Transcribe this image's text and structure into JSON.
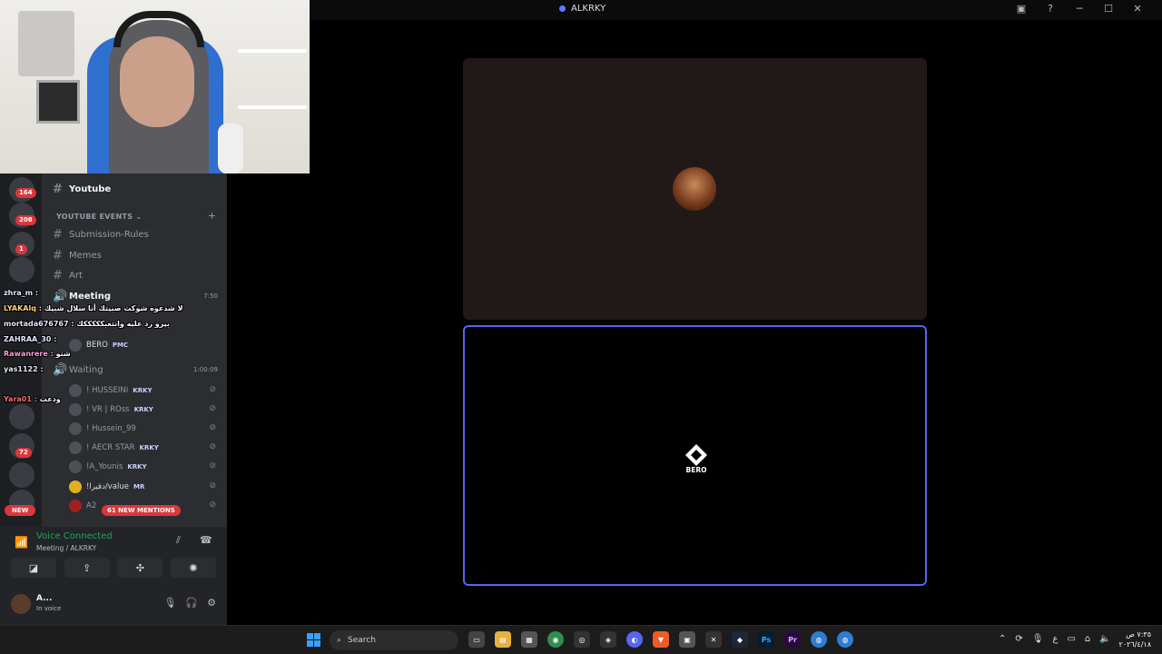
{
  "window": {
    "title": "ALKRKY"
  },
  "servers": {
    "badges": [
      "164",
      "208",
      "1",
      "72"
    ],
    "new_label": "NEW"
  },
  "channels": {
    "top_channel": "Youtube",
    "category": "YOUTUBE EVENTS",
    "items": [
      {
        "name": "Submission-Rules"
      },
      {
        "name": "Memes"
      },
      {
        "name": "Art"
      }
    ],
    "voice_meeting": {
      "name": "Meeting",
      "time": "7:50"
    },
    "meeting_members": [
      {
        "name": "BERO",
        "tag": "PMC"
      }
    ],
    "voice_waiting": {
      "name": "Waiting",
      "time": "1:00:09"
    },
    "waiting_members": [
      {
        "name": "! HUSSEINI",
        "tag": "KRKY"
      },
      {
        "name": "! VR | ROss",
        "tag": "KRKY"
      },
      {
        "name": "! Hussein_99",
        "tag": ""
      },
      {
        "name": "! AECR STAR",
        "tag": "KRKY"
      },
      {
        "name": "!A_Younis",
        "tag": "KRKY"
      },
      {
        "name": "!دقيرا/value",
        "tag": "MR"
      },
      {
        "name": "A2",
        "tag": ""
      }
    ],
    "mentions": "61 NEW MENTIONS"
  },
  "chat": [
    {
      "user": "zhra_m :",
      "msg": ""
    },
    {
      "user": "LYAKAlq :",
      "msg": "لا شدعوه شوكت صبيتك أنا سلال شبيك"
    },
    {
      "user": "mortada676767 :",
      "msg": "بيرو رد عليه وانتعبكككككك"
    },
    {
      "user": "ZAHRAA_30 :",
      "msg": ""
    },
    {
      "user": "Rawanrere :",
      "msg": "شنو"
    },
    {
      "user": "yas1122 :",
      "msg": ""
    },
    {
      "user": "Yara01 :",
      "msg": "ودعت"
    }
  ],
  "voice": {
    "status": "Voice Connected",
    "location": "Meeting / ALKRKY"
  },
  "user": {
    "name": "A...",
    "status": "In voice"
  },
  "stage": {
    "bottom_name": "BERO"
  },
  "taskbar": {
    "search_label": "Search",
    "clock_time": "٧:٣٥ ص",
    "clock_date": "٢٠٢٦/٤/١٨",
    "lang": "ع"
  },
  "colors": {
    "accent": "#5865f2",
    "voice_green": "#23a55a",
    "badge_red": "#da373c"
  }
}
